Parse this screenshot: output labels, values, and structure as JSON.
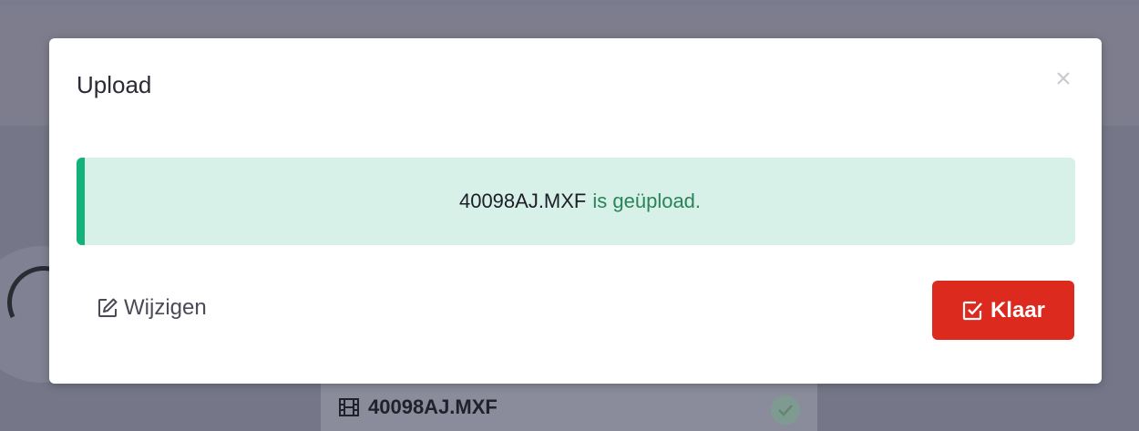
{
  "modal": {
    "title": "Upload",
    "alert": {
      "filename": "40098AJ.MXF",
      "message": "is geüpload."
    },
    "edit_label": "Wijzigen",
    "done_label": "Klaar"
  },
  "background": {
    "file_row_name": "40098AJ.MXF"
  },
  "colors": {
    "accent_red": "#dc2a1f",
    "success_green": "#12b27a",
    "success_bg": "#d7f1e8",
    "overlay": "#7b7b8e"
  },
  "icons": {
    "close": "close-icon",
    "edit": "edit-icon",
    "done": "checkbox-check-icon",
    "film": "film-icon",
    "check": "check-icon",
    "upload": "upload-cloud-icon"
  }
}
